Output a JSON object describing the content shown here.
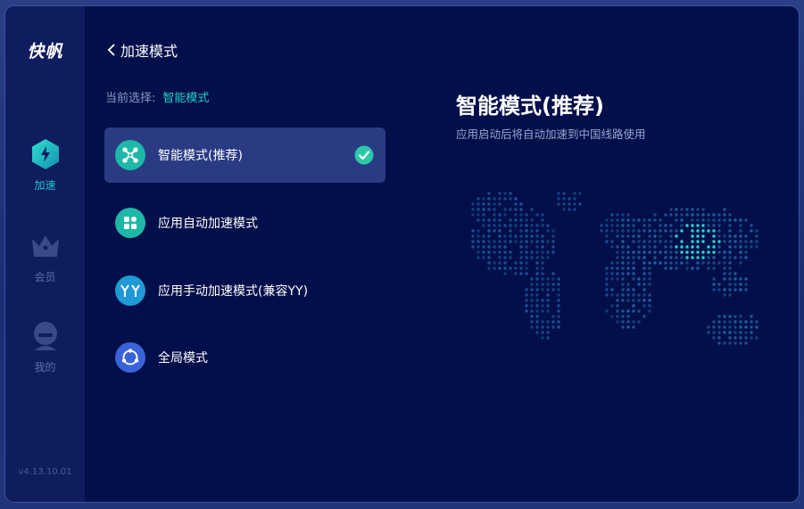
{
  "sidebar": {
    "logo": "快帆",
    "items": [
      {
        "label": "加速"
      },
      {
        "label": "会员"
      },
      {
        "label": "我的"
      }
    ],
    "version": "v4.13.10.01"
  },
  "header": {
    "back_label": "加速模式",
    "current_prefix": "当前选择:",
    "current_value": "智能模式"
  },
  "modes": [
    {
      "label": "智能模式(推荐)",
      "icon": "network-x-icon",
      "color": "#1fb8a8",
      "selected": true
    },
    {
      "label": "应用自动加速模式",
      "icon": "apps-grid-icon",
      "color": "#1fb8a8",
      "selected": false
    },
    {
      "label": "应用手动加速模式(兼容YY)",
      "icon": "yy-icon",
      "color": "#1f9ad6",
      "selected": false
    },
    {
      "label": "全局模式",
      "icon": "globe-arcs-icon",
      "color": "#3b63d9",
      "selected": false
    }
  ],
  "detail": {
    "title": "智能模式(推荐)",
    "description": "应用启动后将自动加速到中国线路使用"
  },
  "colors": {
    "accent": "#25d0c8",
    "background": "#030f4a",
    "sidebar": "#0f1c5e",
    "selected_row": "#2a3b84"
  }
}
